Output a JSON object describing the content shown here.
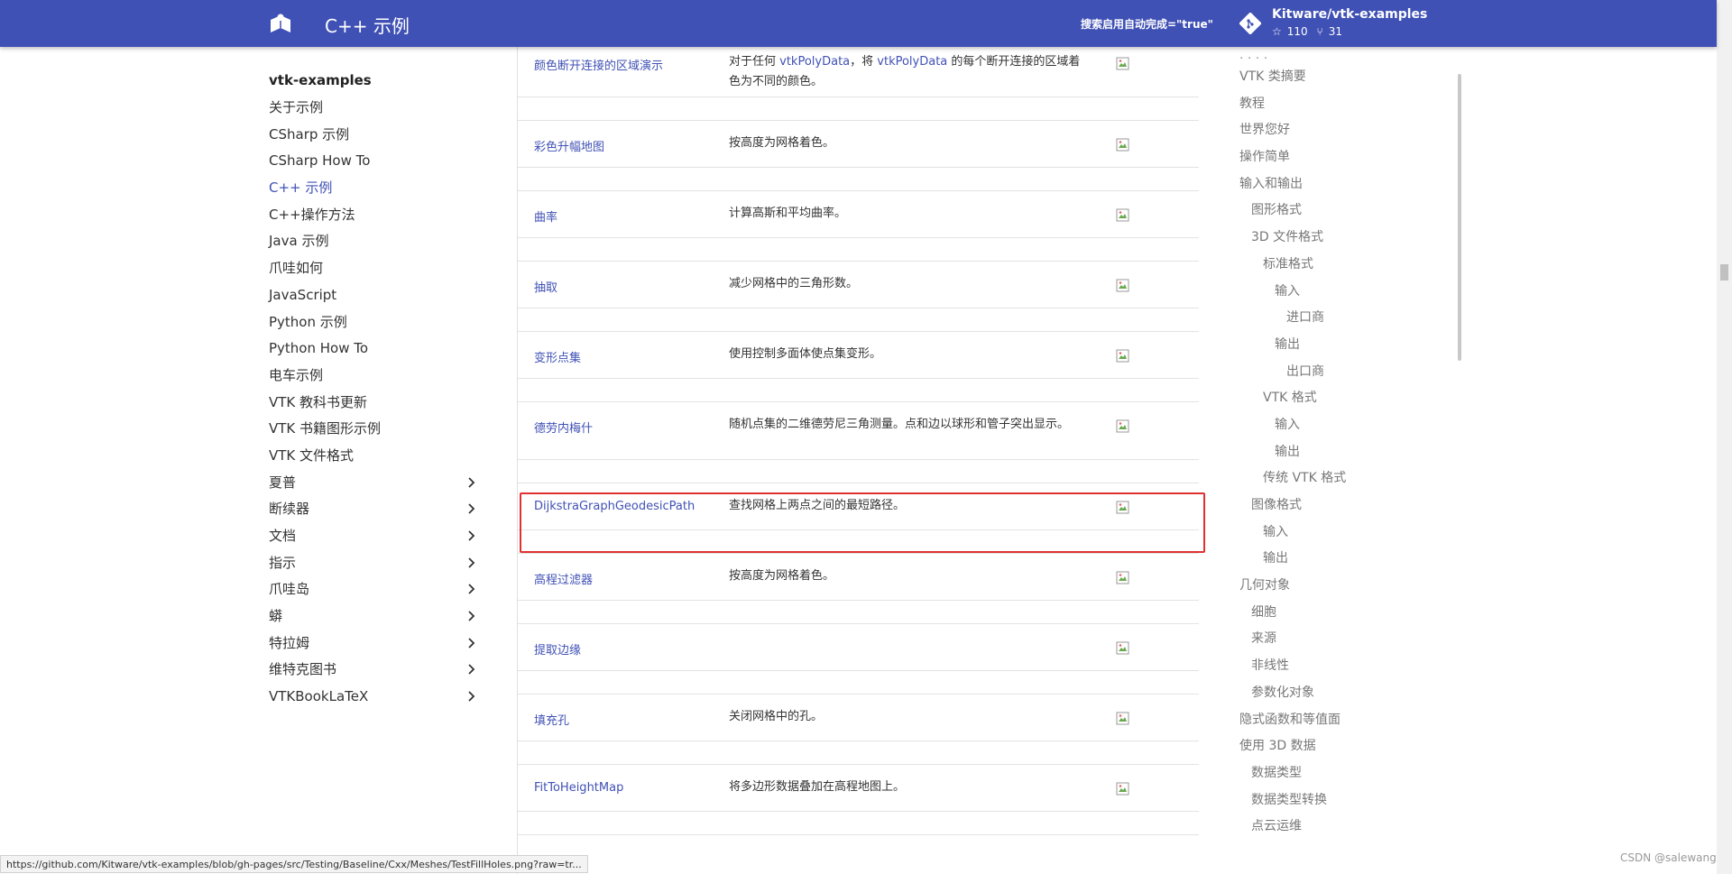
{
  "header": {
    "site_title": "C++ 示例",
    "search_text": "搜索启用自动完成=\"true\"",
    "repo_name": "Kitware/vtk-examples",
    "stars": "110",
    "forks": "31"
  },
  "leftnav": {
    "title": "vtk-examples",
    "items": [
      {
        "label": "关于示例",
        "expandable": false
      },
      {
        "label": "CSharp 示例",
        "expandable": false
      },
      {
        "label": "CSharp How To",
        "expandable": false
      },
      {
        "label": "C++ 示例",
        "expandable": false,
        "active": true
      },
      {
        "label": "C++操作方法",
        "expandable": false
      },
      {
        "label": "Java 示例",
        "expandable": false
      },
      {
        "label": "爪哇如何",
        "expandable": false
      },
      {
        "label": "JavaScript",
        "expandable": false
      },
      {
        "label": "Python 示例",
        "expandable": false
      },
      {
        "label": "Python How To",
        "expandable": false
      },
      {
        "label": "电车示例",
        "expandable": false
      },
      {
        "label": "VTK 教科书更新",
        "expandable": false
      },
      {
        "label": "VTK 书籍图形示例",
        "expandable": false
      },
      {
        "label": "VTK 文件格式",
        "expandable": false
      },
      {
        "label": "夏普",
        "expandable": true
      },
      {
        "label": "断续器",
        "expandable": true
      },
      {
        "label": "文档",
        "expandable": true
      },
      {
        "label": "指示",
        "expandable": true
      },
      {
        "label": "爪哇岛",
        "expandable": true
      },
      {
        "label": "蟒",
        "expandable": true
      },
      {
        "label": "特拉姆",
        "expandable": true
      },
      {
        "label": "维特克图书",
        "expandable": true
      },
      {
        "label": "VTKBookLaTeX",
        "expandable": true
      }
    ]
  },
  "examples": [
    {
      "name": "颜色断开连接的区域演示",
      "desc_parts": [
        {
          "text": "对于任何 ",
          "link": false
        },
        {
          "text": "vtkPolyData",
          "link": true
        },
        {
          "text": "，将 ",
          "link": false
        },
        {
          "text": "vtkPolyData",
          "link": true
        },
        {
          "text": " 的每个断开连接的区域着色为不同的颜色。",
          "link": false
        }
      ]
    },
    {
      "name": "彩色升幅地图",
      "desc_parts": [
        {
          "text": "按高度为网格着色。",
          "link": false
        }
      ]
    },
    {
      "name": "曲率",
      "desc_parts": [
        {
          "text": "计算高斯和平均曲率。",
          "link": false
        }
      ]
    },
    {
      "name": "抽取",
      "desc_parts": [
        {
          "text": "减少网格中的三角形数。",
          "link": false
        }
      ]
    },
    {
      "name": "变形点集",
      "desc_parts": [
        {
          "text": "使用控制多面体使点集变形。",
          "link": false
        }
      ]
    },
    {
      "name": "德劳内梅什",
      "desc_parts": [
        {
          "text": "随机点集的二维德劳尼三角测量。点和边以球形和管子突出显示。",
          "link": false
        }
      ]
    },
    {
      "name": "DijkstraGraphGeodesicPath",
      "desc_parts": [
        {
          "text": "查找网格上两点之间的最短路径。",
          "link": false
        }
      ]
    },
    {
      "name": "高程过滤器",
      "desc_parts": [
        {
          "text": "按高度为网格着色。",
          "link": false
        }
      ]
    },
    {
      "name": "提取边缘",
      "desc_parts": []
    },
    {
      "name": "填充孔",
      "desc_parts": [
        {
          "text": "关闭网格中的孔。",
          "link": false
        }
      ]
    },
    {
      "name": "FitToHeightMap",
      "desc_parts": [
        {
          "text": "将多边形数据叠加在高程地图上。",
          "link": false
        }
      ]
    }
  ],
  "toc": {
    "items": [
      {
        "label": "VTK 类摘要",
        "level": 0
      },
      {
        "label": "教程",
        "level": 0
      },
      {
        "label": "世界您好",
        "level": 0
      },
      {
        "label": "操作简单",
        "level": 0
      },
      {
        "label": "输入和输出",
        "level": 0
      },
      {
        "label": "图形格式",
        "level": 1
      },
      {
        "label": "3D 文件格式",
        "level": 1
      },
      {
        "label": "标准格式",
        "level": 2
      },
      {
        "label": "输入",
        "level": 3
      },
      {
        "label": "进口商",
        "level": 4
      },
      {
        "label": "输出",
        "level": 3
      },
      {
        "label": "出口商",
        "level": 4
      },
      {
        "label": "VTK 格式",
        "level": 2
      },
      {
        "label": "输入",
        "level": 3
      },
      {
        "label": "输出",
        "level": 3
      },
      {
        "label": "传统 VTK 格式",
        "level": 2
      },
      {
        "label": "图像格式",
        "level": 1
      },
      {
        "label": "输入",
        "level": 2
      },
      {
        "label": "输出",
        "level": 2
      },
      {
        "label": "几何对象",
        "level": 0
      },
      {
        "label": "细胞",
        "level": 1
      },
      {
        "label": "来源",
        "level": 1
      },
      {
        "label": "非线性",
        "level": 1
      },
      {
        "label": "参数化对象",
        "level": 1
      },
      {
        "label": "隐式函数和等值面",
        "level": 0
      },
      {
        "label": "使用 3D 数据",
        "level": 0
      },
      {
        "label": "数据类型",
        "level": 1
      },
      {
        "label": "数据类型转换",
        "level": 1
      },
      {
        "label": "点云运维",
        "level": 1
      }
    ]
  },
  "statusbar": {
    "url": "https://github.com/Kitware/vtk-examples/blob/gh-pages/src/Testing/Baseline/Cxx/Meshes/TestFillHoles.png?raw=tr..."
  },
  "watermark": "CSDN @salewang"
}
